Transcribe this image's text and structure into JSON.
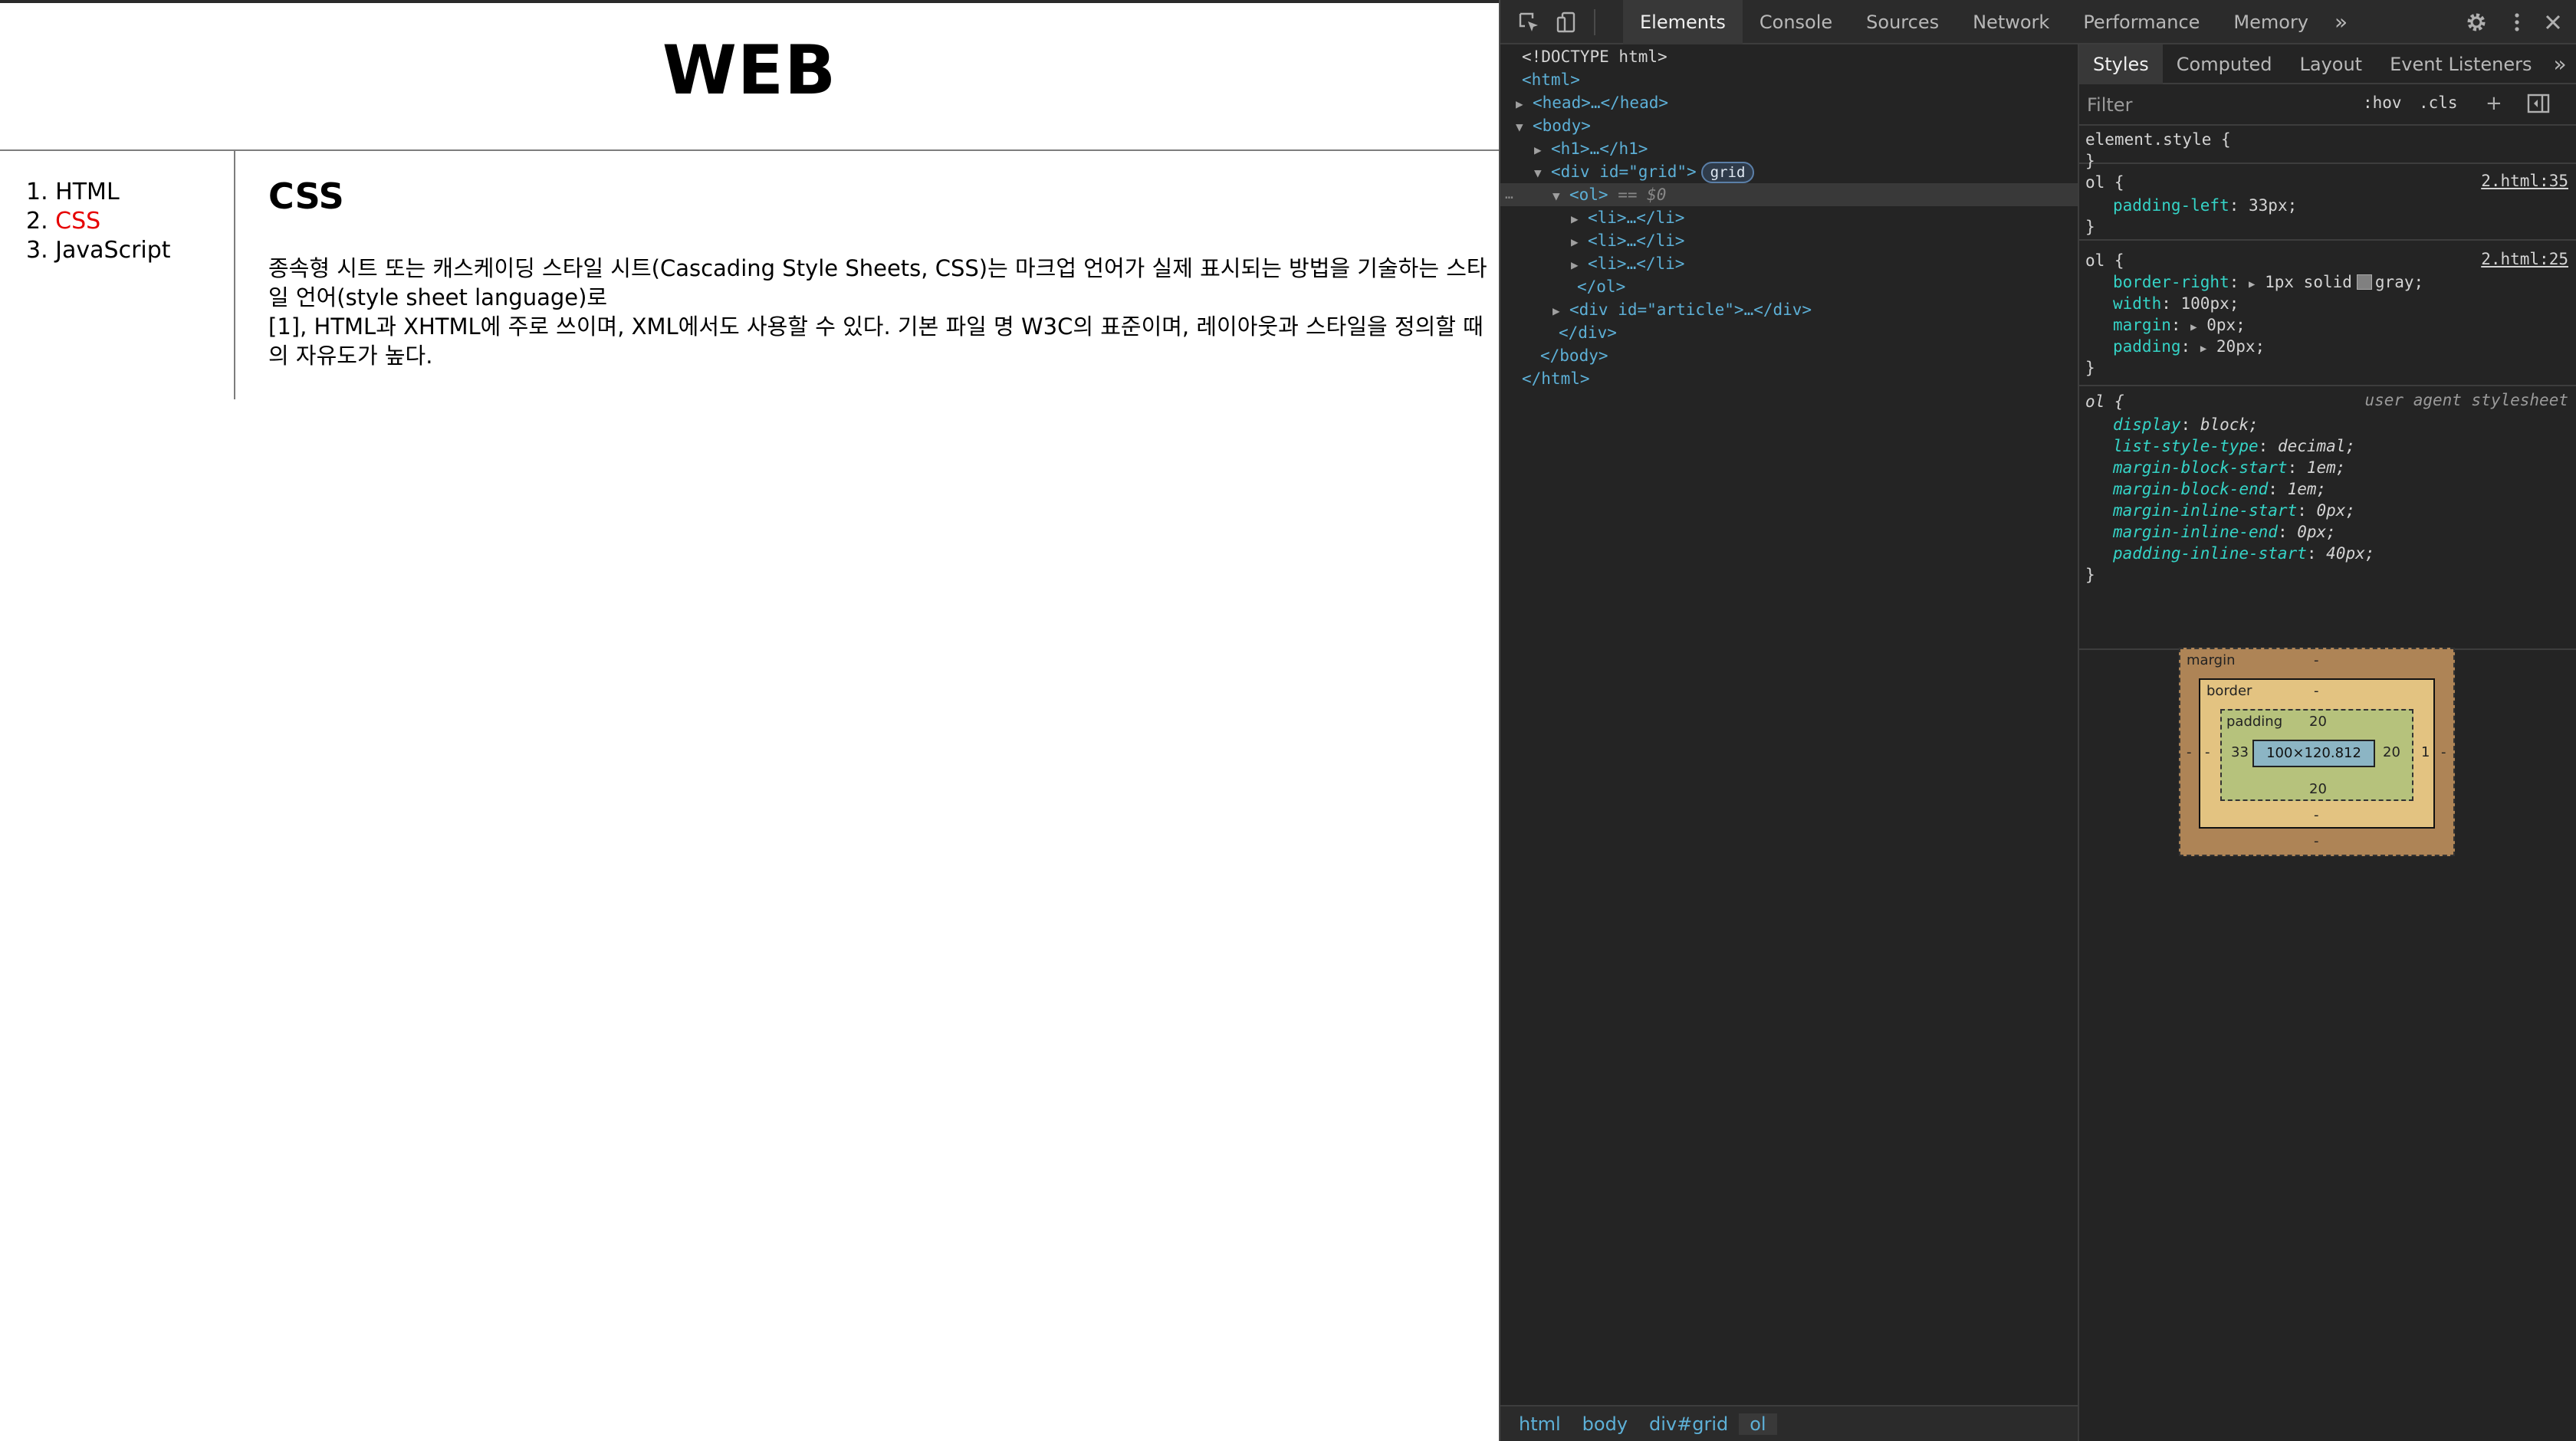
{
  "page": {
    "title": "WEB",
    "nav": [
      {
        "num": "1.",
        "label": "HTML",
        "active": false
      },
      {
        "num": "2.",
        "label": "CSS",
        "active": true
      },
      {
        "num": "3.",
        "label": "JavaScript",
        "active": false
      }
    ],
    "article": {
      "title": "CSS",
      "body": "종속형 시트 또는 캐스케이딩 스타일 시트(Cascading Style Sheets, CSS)는 마크업 언어가 실제 표시되는 방법을 기술하는 스타일 언어(style sheet language)로\n[1], HTML과 XHTML에 주로 쓰이며, XML에서도 사용할 수 있다. 기본 파일 명 W3C의 표준이며, 레이아웃과 스타일을 정의할 때의 자유도가 높다."
    }
  },
  "devtools": {
    "toolbar_icons": [
      "inspect-element-icon",
      "device-toggle-icon"
    ],
    "tabs": [
      "Elements",
      "Console",
      "Sources",
      "Network",
      "Performance",
      "Memory"
    ],
    "active_tab": "Elements",
    "more_tabs": "»",
    "settings_icon": "gear-icon",
    "menu_icon": "kebab-menu-icon",
    "close_icon": "close-icon",
    "dom": {
      "doctype": "<!DOCTYPE html>",
      "html_open": "<html>",
      "head": "<head>…</head>",
      "body_open": "<body>",
      "h1": "<h1>…</h1>",
      "div_grid_open": "<div id=\"grid\">",
      "grid_badge": "grid",
      "ol_open": "<ol>",
      "ol_marker": "== $0",
      "li": "<li>…</li>",
      "ol_close": "</ol>",
      "div_article": "<div id=\"article\">…</div>",
      "div_close": "</div>",
      "body_close": "</body>",
      "html_close": "</html>",
      "dots": "…"
    },
    "breadcrumbs": [
      "html",
      "body",
      "div#grid",
      "ol"
    ],
    "styles": {
      "tabs": [
        "Styles",
        "Computed",
        "Layout",
        "Event Listeners"
      ],
      "active_tab": "Styles",
      "more": "»",
      "filter_placeholder": "Filter",
      "hov": ":hov",
      "cls": ".cls",
      "plus": "+",
      "rules": [
        {
          "selector": "element.style {",
          "close": "}",
          "source": "",
          "props": []
        },
        {
          "selector": "ol {",
          "close": "}",
          "source": "2.html:35",
          "props": [
            {
              "name": "padding-left",
              "value": "33px;"
            }
          ]
        },
        {
          "selector": "ol {",
          "close": "}",
          "source": "2.html:25",
          "props": [
            {
              "name": "border-right",
              "value": "1px solid",
              "color": "gray;"
            },
            {
              "name": "width",
              "value": "100px;"
            },
            {
              "name": "margin",
              "value": "0px;"
            },
            {
              "name": "padding",
              "value": "20px;"
            }
          ]
        },
        {
          "selector": "ol {",
          "close": "}",
          "source": "user agent stylesheet",
          "props": [
            {
              "name": "display",
              "value": "block;"
            },
            {
              "name": "list-style-type",
              "value": "decimal;"
            },
            {
              "name": "margin-block-start",
              "value": "1em;"
            },
            {
              "name": "margin-block-end",
              "value": "1em;"
            },
            {
              "name": "margin-inline-start",
              "value": "0px;"
            },
            {
              "name": "margin-inline-end",
              "value": "0px;"
            },
            {
              "name": "padding-inline-start",
              "value": "40px;"
            }
          ]
        }
      ],
      "swatch_color": "#808080"
    },
    "box_model": {
      "margin_label": "margin",
      "margin_top": "-",
      "margin_bottom": "-",
      "margin_left": "-",
      "margin_right": "-",
      "border_label": "border",
      "border_top": "-",
      "border_bottom": "-",
      "border_left": "-",
      "border_right": "1",
      "padding_label": "padding",
      "padding_top": "20",
      "padding_bottom": "20",
      "padding_left": "33",
      "padding_right": "20",
      "content": "100×120.812"
    }
  }
}
